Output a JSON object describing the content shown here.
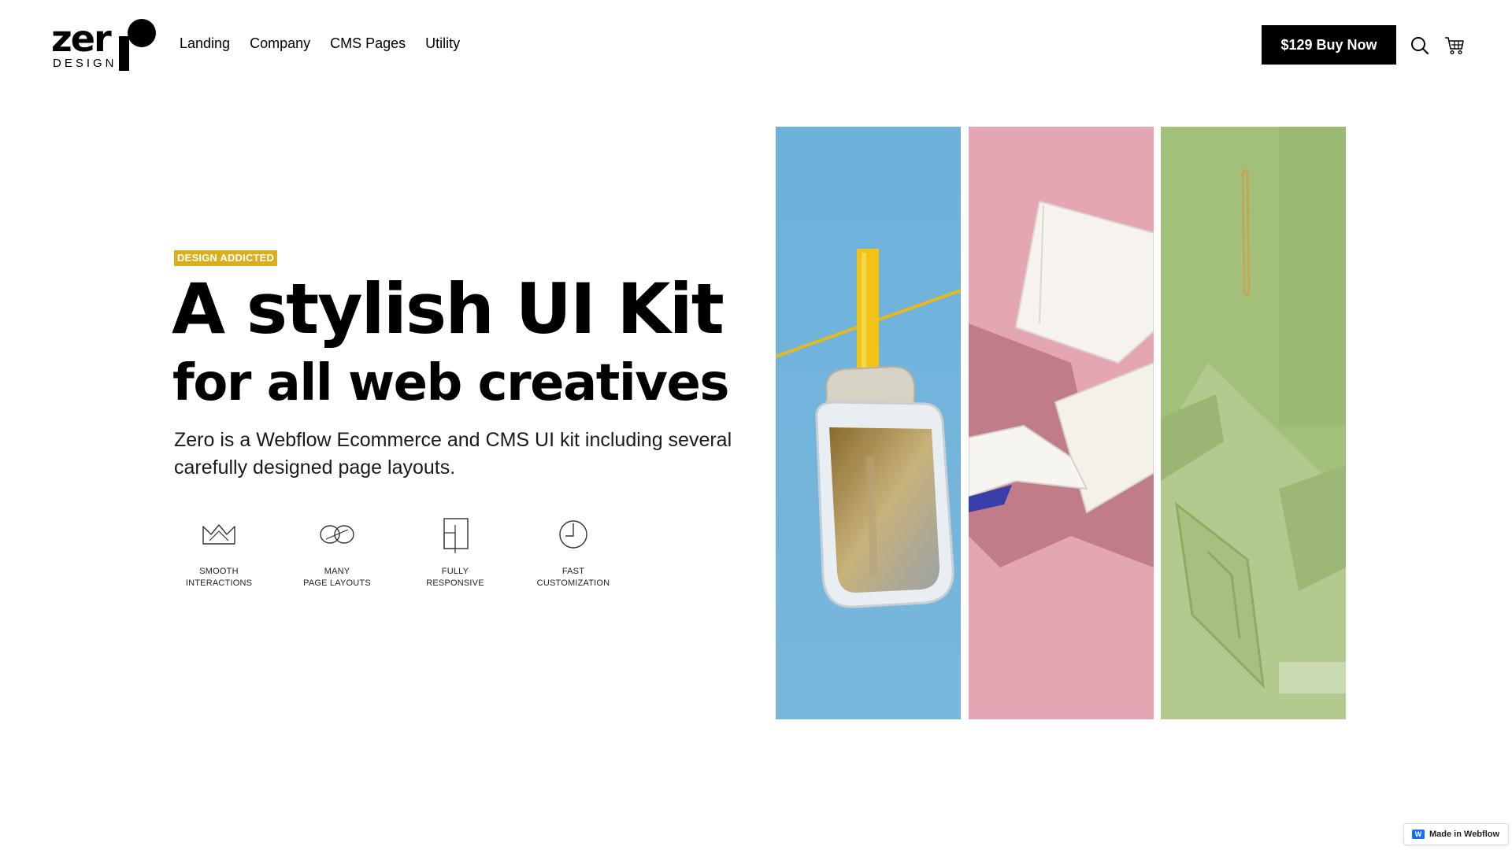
{
  "header": {
    "logo": {
      "wordmark": "zer",
      "subtitle": "DESIGN"
    },
    "nav": [
      {
        "label": "Landing"
      },
      {
        "label": "Company"
      },
      {
        "label": "CMS Pages"
      },
      {
        "label": "Utility"
      }
    ],
    "buy_button": "$129 Buy Now",
    "icons": {
      "search": "search-icon",
      "cart": "cart-icon"
    }
  },
  "hero": {
    "tag": "DESIGN ADDICTED",
    "title": "A stylish UI Kit",
    "subtitle": "for all web creatives",
    "lead": "Zero is a Webflow Ecommerce and CMS UI kit including several carefully designed page layouts.",
    "tag_color": "#dcae1d",
    "features": [
      {
        "icon": "crown-icon",
        "label": "SMOOTH\nINTERACTIONS"
      },
      {
        "icon": "infinity-icon",
        "label": "MANY\nPAGE LAYOUTS"
      },
      {
        "icon": "responsive-icon",
        "label": "FULLY\nRESPONSIVE"
      },
      {
        "icon": "clock-icon",
        "label": "FAST\nCUSTOMIZATION"
      }
    ]
  },
  "gallery": {
    "panels": [
      {
        "name": "sardine-can-image",
        "bg": "#6fb0d6"
      },
      {
        "name": "books-image",
        "bg": "#e3a4af"
      },
      {
        "name": "paper-clip-image",
        "bg": "#a5c27c"
      }
    ]
  },
  "badge": {
    "label": "Made in Webflow",
    "icon_letter": "W",
    "brand_color": "#146ef5"
  }
}
